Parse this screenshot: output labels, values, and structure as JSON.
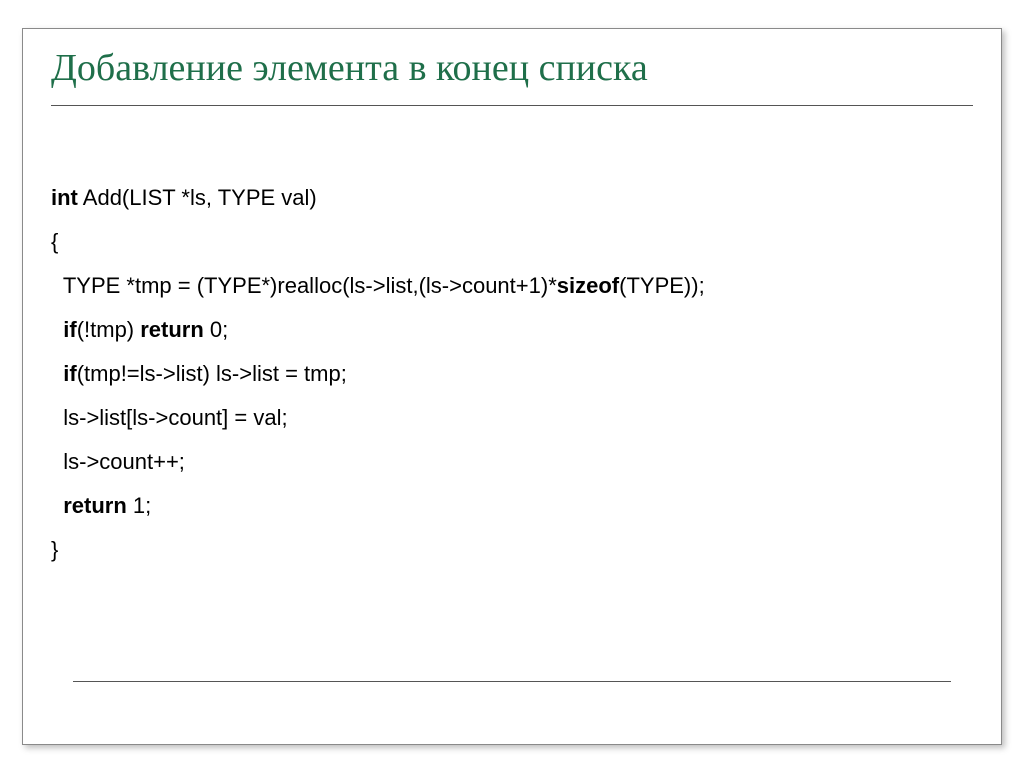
{
  "title": "Добавление элемента в конец списка",
  "code": {
    "l1_kw": "int",
    "l1_rest": " Add(LIST *ls, TYPE val)",
    "l2": "{",
    "l3": "  TYPE *tmp = (TYPE*)realloc(ls->list,(ls->count+1)*",
    "l3_kw": "sizeof",
    "l3_rest2": "(TYPE));",
    "l4_pre": "  ",
    "l4_kw1": "if",
    "l4_mid": "(!tmp) ",
    "l4_kw2": "return",
    "l4_end": " 0;",
    "l5_pre": "  ",
    "l5_kw": "if",
    "l5_end": "(tmp!=ls->list) ls->list = tmp;",
    "l6": "  ls->list[ls->count] = val;",
    "l7": "  ls->count++;",
    "l8_pre": "  ",
    "l8_kw": "return",
    "l8_end": " 1;",
    "l9": "}"
  }
}
